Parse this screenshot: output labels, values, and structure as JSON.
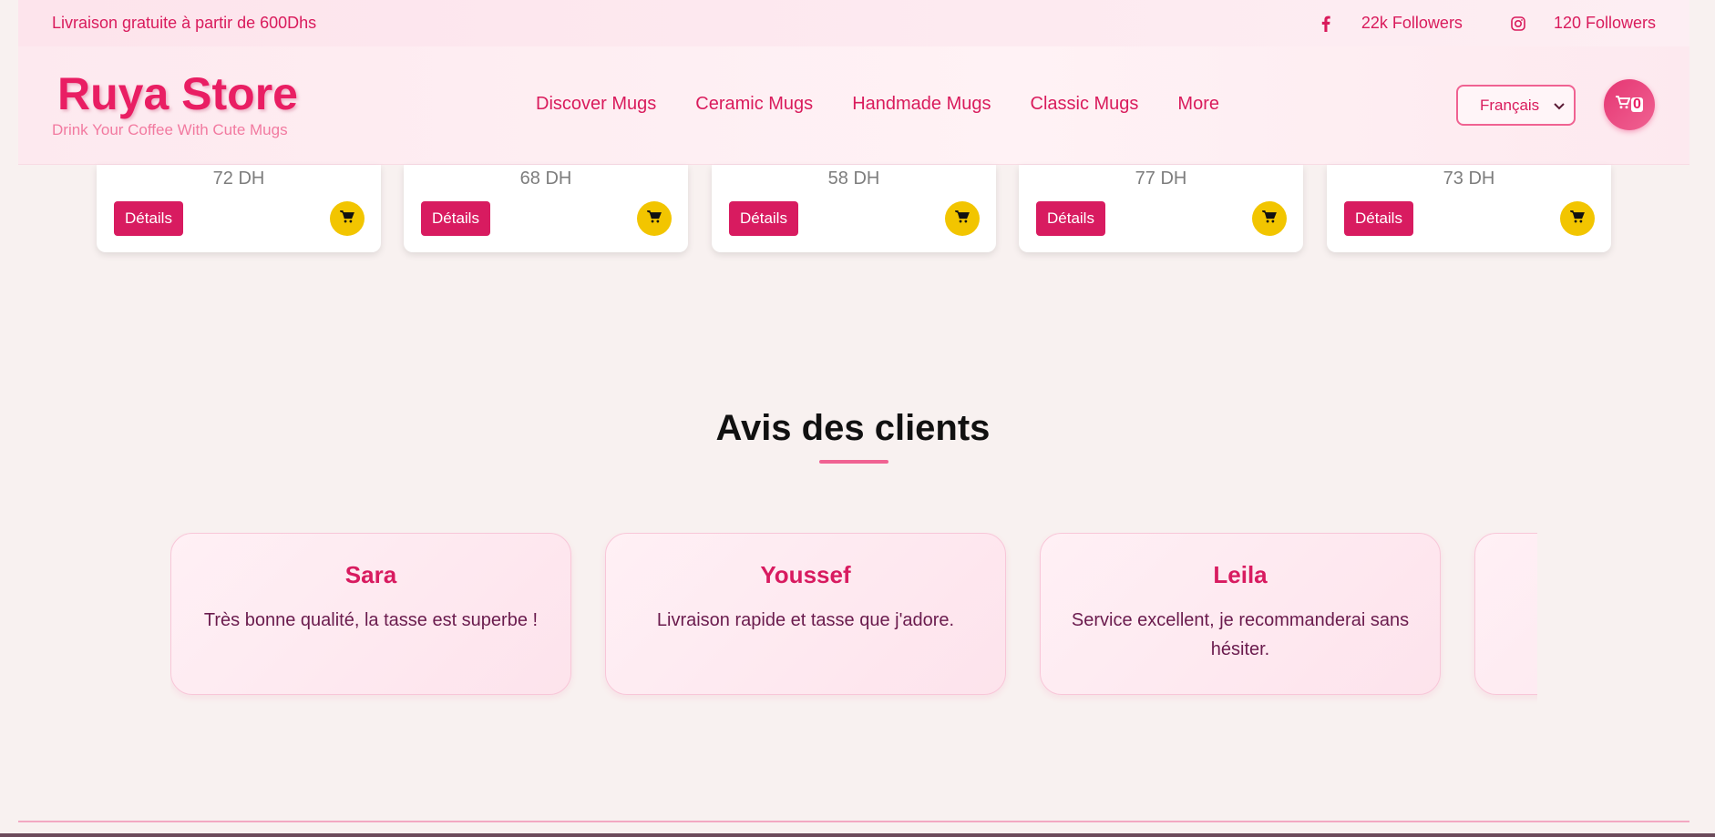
{
  "top_bar": {
    "shipping_notice": "Livraison gratuite à partir de 600Dhs",
    "facebook_followers": "22k Followers",
    "instagram_followers": "120 Followers"
  },
  "header": {
    "brand_title": "Ruya Store",
    "brand_tagline": "Drink Your Coffee With Cute Mugs",
    "nav": [
      "Discover Mugs",
      "Ceramic Mugs",
      "Handmade Mugs",
      "Classic Mugs",
      "More"
    ],
    "language_selected": "Français",
    "cart_count": "0"
  },
  "products": [
    {
      "price": "72 DH",
      "details_label": "Détails"
    },
    {
      "price": "68 DH",
      "details_label": "Détails"
    },
    {
      "price": "58 DH",
      "details_label": "Détails"
    },
    {
      "price": "77 DH",
      "details_label": "Détails"
    },
    {
      "price": "73 DH",
      "details_label": "Détails"
    }
  ],
  "reviews": {
    "title": "Avis des clients",
    "items": [
      {
        "name": "Sara",
        "text": "Très bonne qualité, la tasse est superbe !"
      },
      {
        "name": "Youssef",
        "text": "Livraison rapide et tasse que j'adore."
      },
      {
        "name": "Leila",
        "text": "Service excellent, je recommanderai sans hésiter."
      },
      {
        "name": "",
        "text": ""
      }
    ]
  },
  "colors": {
    "brand_pink": "#e91e63",
    "button_pink": "#d81b60",
    "cart_yellow": "#f2c500",
    "page_bg": "#f8f1f0"
  },
  "icons": {
    "facebook": "facebook-icon",
    "instagram": "instagram-icon",
    "cart": "cart-icon",
    "chevron": "chevron-down-icon"
  }
}
